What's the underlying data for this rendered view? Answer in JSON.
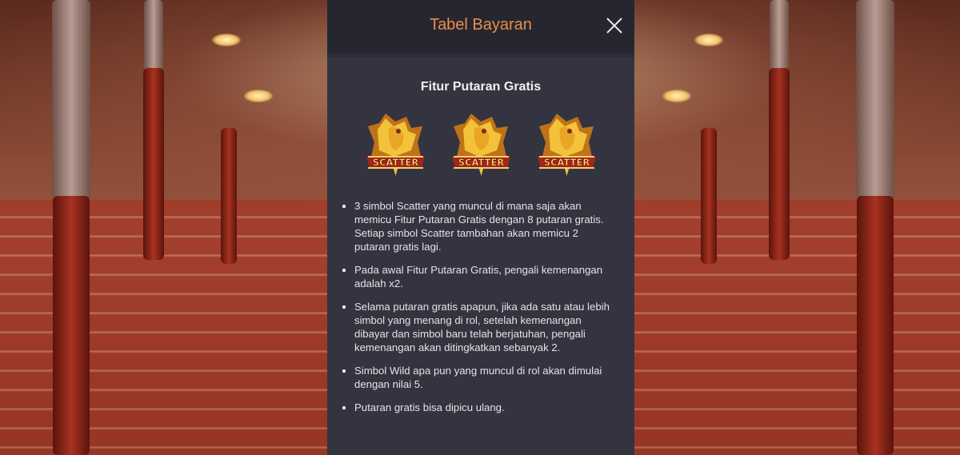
{
  "panel": {
    "title": "Tabel Bayaran",
    "section_title": "Fitur Putaran Gratis",
    "scatter_symbols": [
      {
        "icon": "scatter-rooster-icon",
        "label": "SCATTER"
      },
      {
        "icon": "scatter-rooster-icon",
        "label": "SCATTER"
      },
      {
        "icon": "scatter-rooster-icon",
        "label": "SCATTER"
      }
    ],
    "rules": [
      "3 simbol Scatter yang muncul di mana saja akan memicu Fitur Putaran Gratis dengan 8 putaran gratis. Setiap simbol Scatter tambahan akan memicu 2 putaran gratis lagi.",
      "Pada awal Fitur Putaran Gratis, pengali kemenangan adalah x2.",
      "Selama putaran gratis apapun, jika ada satu atau lebih simbol yang menang di rol, setelah kemenangan dibayar dan simbol baru telah berjatuhan, pengali kemenangan akan ditingkatkan sebanyak 2.",
      "Simbol Wild apa pun yang muncul di rol akan dimulai dengan nilai 5.",
      "Putaran gratis bisa dipicu ulang."
    ]
  },
  "colors": {
    "title_accent": "#e88f48",
    "panel_bg": "#33343f",
    "header_bg": "#262630"
  }
}
